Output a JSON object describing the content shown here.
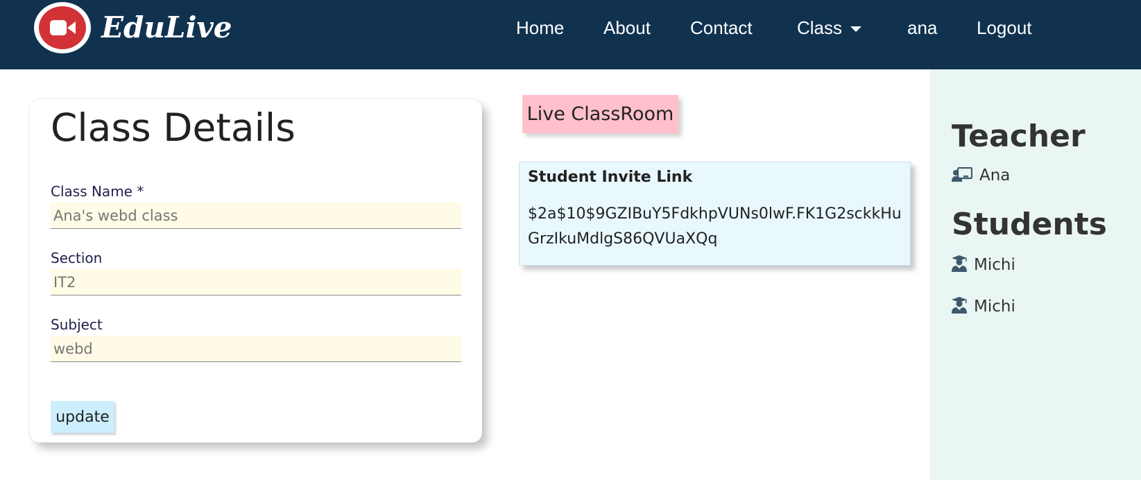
{
  "brand": {
    "name": "EduLive",
    "logo_icon": "video-camera-icon",
    "logo_color": "#d23235"
  },
  "nav": {
    "items": [
      "Home",
      "About",
      "Contact",
      "Class",
      "ana",
      "Logout"
    ],
    "background": "#10324f"
  },
  "class_details": {
    "title": "Class Details",
    "class_name_label": "Class Name *",
    "class_name_placeholder": "Ana's webd class",
    "section_label": "Section",
    "section_placeholder": "IT2",
    "subject_label": "Subject",
    "subject_placeholder": "webd",
    "update_label": "update"
  },
  "live": {
    "label": "Live ClassRoom",
    "color": "#ffc0cb"
  },
  "invite": {
    "title": "Student Invite Link",
    "link": "$2a$10$9GZIBuY5FdkhpVUNs0lwF.FK1G2sckkHuGrzIkuMdlgS86QVUaXQq"
  },
  "sidebar": {
    "teacher_heading": "Teacher",
    "teacher": {
      "name": "Ana",
      "icon": "chalkboard-teacher-icon"
    },
    "students_heading": "Students",
    "students": [
      {
        "name": "Michi",
        "icon": "user-graduate-icon"
      },
      {
        "name": "Michi",
        "icon": "user-graduate-icon"
      }
    ],
    "background": "#eaf6f4"
  }
}
